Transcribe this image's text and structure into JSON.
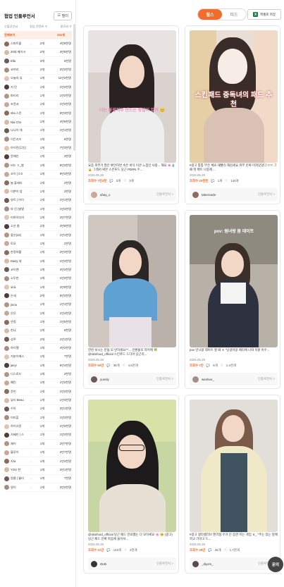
{
  "left_panel": {
    "title": "협업 인플루언서",
    "filter_label": "필터",
    "columns": [
      "인플루언서",
      "협업 콘텐츠 수",
      "팔로워 수"
    ],
    "rows": [
      {
        "name": "전체보기",
        "count": "",
        "followers": "241개",
        "highlight": true
      },
      {
        "name": "스마트몰",
        "count": "2개",
        "followers": "4만9천명"
      },
      {
        "name": "20대 메이크",
        "count": "2개",
        "followers": "3만9천명"
      },
      {
        "name": "Ella",
        "count": "3개",
        "followers": "6천명"
      },
      {
        "name": "코끼리",
        "count": "2개",
        "followers": "2만2천명"
      },
      {
        "name": "오늘의 뷰",
        "count": "1개",
        "followers": "11만2천명"
      },
      {
        "name": "지 민",
        "count": "1개",
        "followers": "1만2천명"
      },
      {
        "name": "파티리",
        "count": "1개",
        "followers": "1만2천명"
      },
      {
        "name": "조윤서",
        "count": "1개",
        "followers": "1만3천명"
      },
      {
        "name": "sha 스킨",
        "count": "1개",
        "followers": "6만3천명"
      },
      {
        "name": "Nia Cho",
        "count": "1개",
        "followers": "4만9천명"
      },
      {
        "name": "나나이 대",
        "count": "1개",
        "followers": "1만1천명"
      },
      {
        "name": "이든키즈",
        "count": "1개",
        "followers": "5천명"
      },
      {
        "name": "아이린(무인)",
        "count": "1개",
        "followers": "7만3천명"
      },
      {
        "name": "윤해인",
        "count": "1개",
        "followers": "3천명"
      },
      {
        "name": "비드 ㅎ_봄",
        "count": "1개",
        "followers": "8만3천명"
      },
      {
        "name": "조이 | 0.0",
        "count": "1개",
        "followers": "9만3천명"
      },
      {
        "name": "늘 플래티",
        "count": "1개",
        "followers": "2천명"
      },
      {
        "name": "이쁜이 엄",
        "count": "1개",
        "followers": "3천명"
      },
      {
        "name": "뮤트 | 아이",
        "count": "1개",
        "followers": "1만1천명"
      },
      {
        "name": "야 진 (발랄",
        "count": "1개",
        "followers": "1만2천명"
      },
      {
        "name": "미하이다이",
        "count": "1개",
        "followers": "2만7천명"
      },
      {
        "name": "소은 봄",
        "count": "2개",
        "followers": "3만6천명"
      },
      {
        "name": "좋은(22)",
        "count": "1개",
        "followers": "1만1천명"
      },
      {
        "name": "토모",
        "count": "1개",
        "followers": "2천명"
      },
      {
        "name": "한정아를",
        "count": "1개",
        "followers": "2만3천명"
      },
      {
        "name": "Daisy 데",
        "count": "1개",
        "followers": "1만4천명"
      },
      {
        "name": "코이엔",
        "count": "1개",
        "followers": "4만2천명"
      },
      {
        "name": "소두빈",
        "count": "1개",
        "followers": "1만2천명"
      },
      {
        "name": "요요",
        "count": "1개",
        "followers": "4만9천명"
      },
      {
        "name": "은세",
        "count": "2개",
        "followers": "6만3천명"
      },
      {
        "name": "jinna",
        "count": "1개",
        "followers": "1만1천명"
      },
      {
        "name": "은은",
        "count": "1개",
        "followers": "1만4천명"
      },
      {
        "name": "연정",
        "count": "1개",
        "followers": "1만5천명"
      },
      {
        "name": "한냐",
        "count": "1개",
        "followers": "9천명"
      },
      {
        "name": "성주",
        "count": "2개",
        "followers": "1만1천명"
      },
      {
        "name": "하이엘",
        "count": "1개",
        "followers": "4만2천명"
      },
      {
        "name": "저분이에스",
        "count": "1개",
        "followers": "7천명"
      },
      {
        "name": "jaeyi",
        "count": "1개",
        "followers": "5만4천명"
      },
      {
        "name": "디스로드",
        "count": "1개",
        "followers": "2천명"
      },
      {
        "name": "예린",
        "count": "1개",
        "followers": "1만2천명"
      },
      {
        "name": "윤빈",
        "count": "1개",
        "followers": "1만2천명"
      },
      {
        "name": "뷰티 Beau",
        "count": "1개",
        "followers": "1만4천명"
      },
      {
        "name": "수아",
        "count": "1개",
        "followers": "2만1천명"
      },
      {
        "name": "미미훈",
        "count": "1개",
        "followers": "1만2천명"
      },
      {
        "name": "하이사랑",
        "count": "1개",
        "followers": "1만3천명"
      },
      {
        "name": "지혜인 | 스",
        "count": "1개",
        "followers": "1만2천명"
      },
      {
        "name": "제이",
        "count": "1개",
        "followers": "2만7천명"
      },
      {
        "name": "블루이",
        "count": "1개",
        "followers": "2만7천명"
      },
      {
        "name": "지요",
        "count": "1개",
        "followers": "1만2천명"
      },
      {
        "name": "YOU 한",
        "count": "1개",
        "followers": "3만1천명"
      },
      {
        "name": "원클 | 퀄리",
        "count": "1개",
        "followers": "7천명"
      },
      {
        "name": "영이",
        "count": "1개",
        "followers": "2만2천명"
      }
    ]
  },
  "topbar": {
    "tabs": [
      "릴스",
      "피드"
    ],
    "active_tab": "릴스",
    "excel_label": "엑셀로 저장"
  },
  "cards": [
    {
      "caption": "요즘 피부가 많은 뽀얀하면 속은 바닥 이콘 느낌인 사랑... 해요 🌸💧🔒 그래서 써본 스킨푸드 당근 PDRN 수...",
      "overlay": "나는 물광피부 만드는 방법이 있어 😊",
      "date": "2026.05.28",
      "views": "조회수 7천4천",
      "likes": "3개",
      "comments": "3개",
      "username": "ahay_u",
      "link": "인플루언서 >"
    },
    {
      "caption": "#광고 퉁퉁 부은 체로 재빨리 해감세요 피부 진짜 미쳐있었다 ㅠㅠ 그때 뭐 팩트 나중제 ...",
      "overlay": "스킨패드 중독녀의 패드 추천",
      "date": "2026.05.29",
      "views": "조회수 20천천",
      "likes": "1개",
      "comments": "140개",
      "username": "tabernacle",
      "link": "인플루언서 >"
    },
    {
      "caption": "한번 보시는 분들 모 반하세요^^... 전환쓸모 하이에 🍀 @skinfood_official 스킨푸드 드디어 당근리...",
      "overlay": "",
      "date": "2026.05.28",
      "views": "조회수 60만",
      "likes": "38개",
      "comments": "4.6천개",
      "username": "yunnly",
      "link": "인플루언서 >"
    },
    {
      "caption": "pov 인니랑 데이트 할 때 ㅎ \"당굴이랑 페리에 나와 지원 이수...",
      "overlay": "pov: 썸녀랑 봄 데이트",
      "date": "2026.05.29",
      "views": "조회수 7만",
      "likes": "8개",
      "comments": "1.4천개",
      "username": "weehee_",
      "link": "인플루언서 >"
    },
    {
      "caption": "@skinfood_official 당근 패드 만료했는 다 모이세요 🌸 🥺 (광고) 당근 패드 진짜 마음에 들어서...",
      "overlay": "",
      "date": "2026.05.28",
      "views": "조회수 21만",
      "likes": "143개",
      "comments": "2천개",
      "username": "i0o0i",
      "link": "인플루언서 >"
    },
    {
      "caption": "#광고 생리셀러브 맨걱정 수가 단 잠깐 이는 게임 ㅎ_ \"주는 있는 날에 학교 가야고 드...",
      "overlay": "",
      "date": "2026.05.28",
      "views": "조회수 28만",
      "likes": "36개",
      "comments": "1.7천개",
      "username": "_diyom_",
      "link": "인플루언서 >"
    }
  ],
  "chat_label": "문의"
}
